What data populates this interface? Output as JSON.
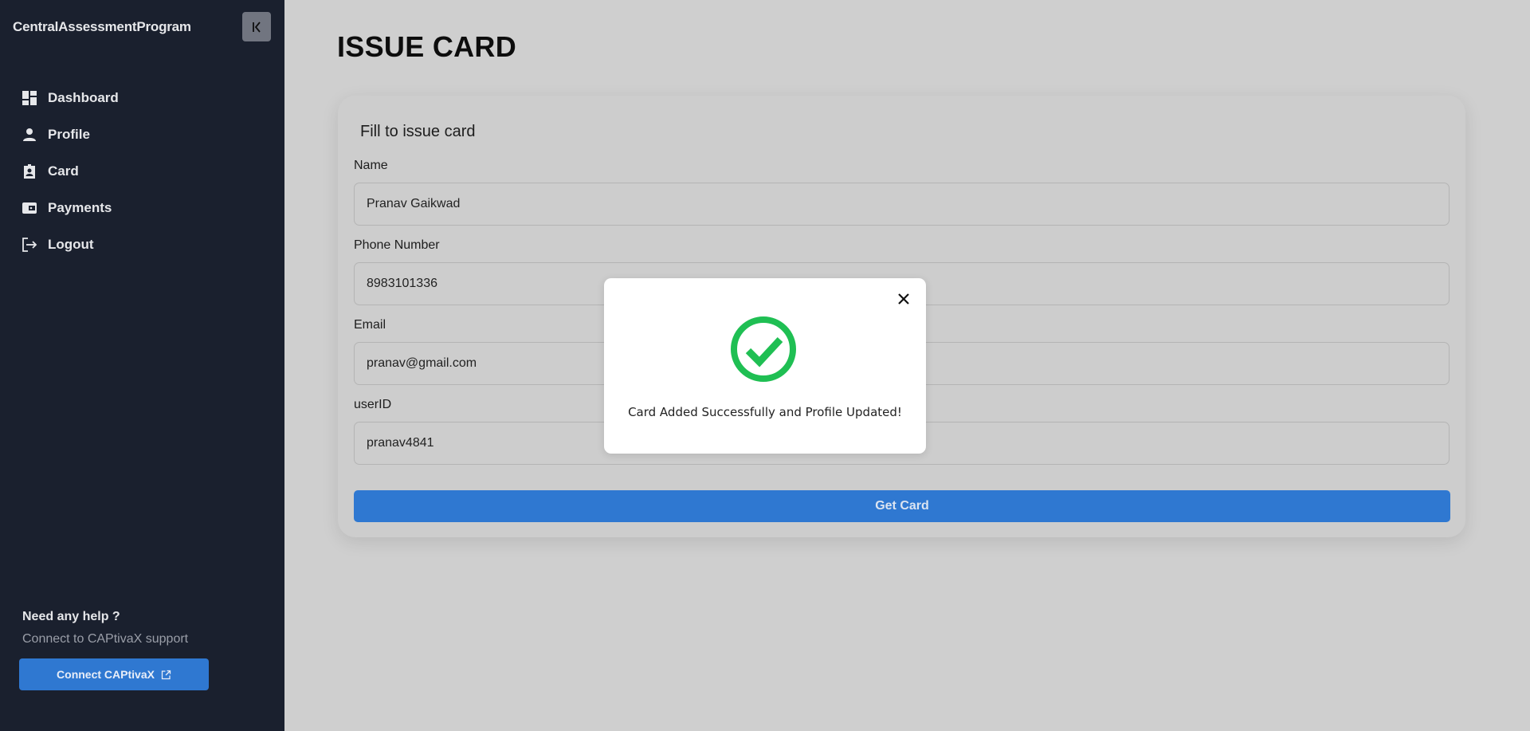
{
  "sidebar": {
    "brand": "CentralAssessmentProgram",
    "items": [
      {
        "label": "Dashboard",
        "icon": "dashboard-icon"
      },
      {
        "label": "Profile",
        "icon": "person-icon"
      },
      {
        "label": "Card",
        "icon": "badge-icon"
      },
      {
        "label": "Payments",
        "icon": "wallet-icon"
      },
      {
        "label": "Logout",
        "icon": "logout-icon"
      }
    ],
    "help_title": "Need any help ?",
    "help_subtitle": "Connect to CAPtivaX support",
    "connect_label": "Connect CAPtivaX"
  },
  "page": {
    "title": "ISSUE CARD"
  },
  "form": {
    "title": "Fill to issue card",
    "fields": [
      {
        "label": "Name",
        "value": "Pranav Gaikwad"
      },
      {
        "label": "Phone Number",
        "value": "8983101336"
      },
      {
        "label": "Email",
        "value": "pranav@gmail.com"
      },
      {
        "label": "userID",
        "value": "pranav4841"
      }
    ],
    "submit_label": "Get Card"
  },
  "modal": {
    "message": "Card Added Successfully and Profile Updated!",
    "icon": "check-circle-icon"
  },
  "colors": {
    "sidebar_bg": "#1a202e",
    "accent": "#2f78d1",
    "success": "#1fbf53",
    "overlay_bg": "#cfcfcf"
  }
}
